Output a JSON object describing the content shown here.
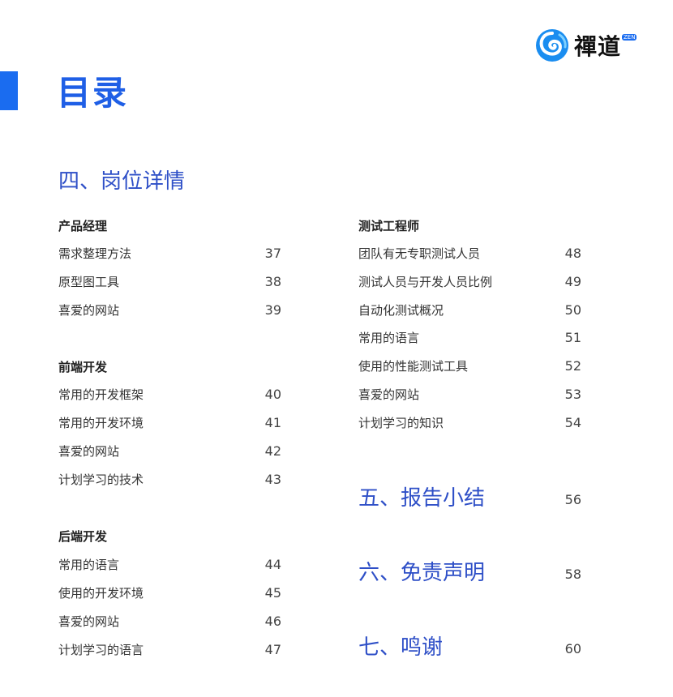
{
  "header": {
    "title": "目录",
    "logo_text": "禪道",
    "logo_badge": "ZEN"
  },
  "section4": {
    "heading": "四、岗位详情",
    "groups": [
      {
        "title": "产品经理",
        "items": [
          {
            "label": "需求整理方法",
            "page": "37"
          },
          {
            "label": "原型图工具",
            "page": "38"
          },
          {
            "label": "喜爱的网站",
            "page": "39"
          }
        ]
      },
      {
        "title": "前端开发",
        "items": [
          {
            "label": "常用的开发框架",
            "page": "40"
          },
          {
            "label": "常用的开发环境",
            "page": "41"
          },
          {
            "label": "喜爱的网站",
            "page": "42"
          },
          {
            "label": "计划学习的技术",
            "page": "43"
          }
        ]
      },
      {
        "title": "后端开发",
        "items": [
          {
            "label": "常用的语言",
            "page": "44"
          },
          {
            "label": "使用的开发环境",
            "page": "45"
          },
          {
            "label": "喜爱的网站",
            "page": "46"
          },
          {
            "label": "计划学习的语言",
            "page": "47"
          }
        ]
      },
      {
        "title": "测试工程师",
        "items": [
          {
            "label": "团队有无专职测试人员",
            "page": "48"
          },
          {
            "label": "测试人员与开发人员比例",
            "page": "49"
          },
          {
            "label": "自动化测试概况",
            "page": "50"
          },
          {
            "label": "常用的语言",
            "page": "51"
          },
          {
            "label": "使用的性能测试工具",
            "page": "52"
          },
          {
            "label": "喜爱的网站",
            "page": "53"
          },
          {
            "label": "计划学习的知识",
            "page": "54"
          }
        ]
      }
    ]
  },
  "major_sections": [
    {
      "label": "五、报告小结",
      "page": "56"
    },
    {
      "label": "六、免责声明",
      "page": "58"
    },
    {
      "label": "七、鸣谢",
      "page": "60"
    }
  ],
  "colors": {
    "accent": "#1a6cf0",
    "heading_blue": "#2e4fc7"
  }
}
